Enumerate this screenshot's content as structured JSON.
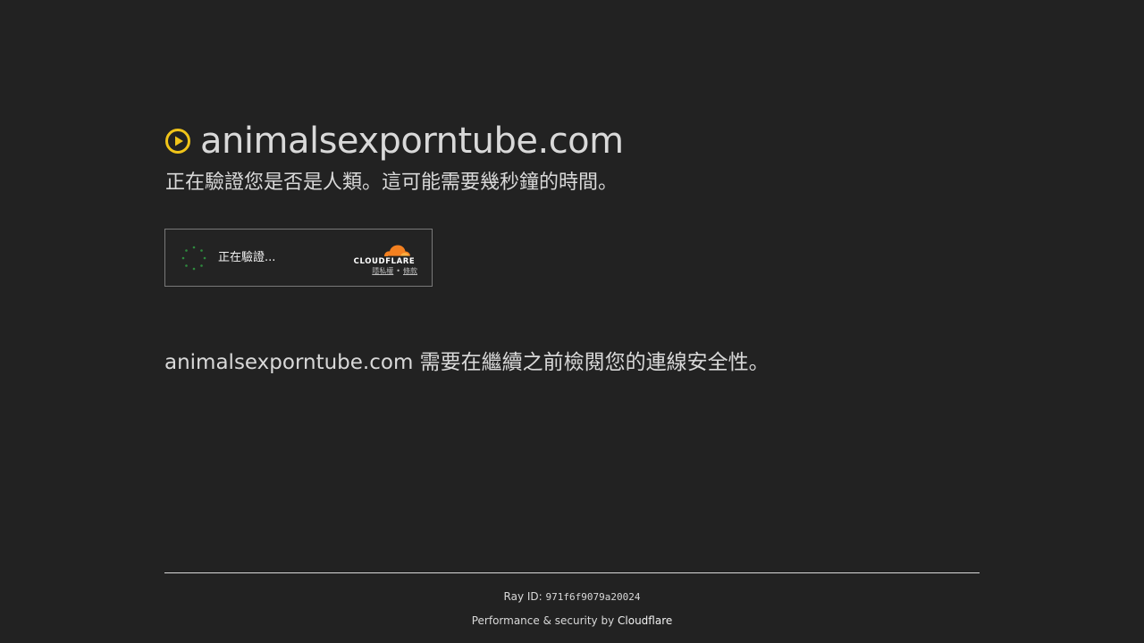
{
  "header": {
    "site_name": "animalsexporntube.com",
    "icon": "play-circle-icon",
    "icon_color": "#f0c419"
  },
  "subtitle": "正在驗證您是否是人類。這可能需要幾秒鐘的時間。",
  "widget": {
    "status_label": "正在驗證...",
    "spinner_icon": "loading-spinner-icon",
    "spinner_color": "#2e8b3e",
    "brand_logo": "cloudflare-logo",
    "brand_text": "CLOUDFLARE",
    "brand_color": "#f38020",
    "privacy_link": "隱私權",
    "separator": "•",
    "terms_link": "條款"
  },
  "message": {
    "site_name": "animalsexporntube.com",
    "text": " 需要在繼續之前檢閱您的連線安全性。"
  },
  "footer": {
    "ray_label": "Ray ID: ",
    "ray_id": "971f6f9079a20024",
    "perf_text": "Performance & security by ",
    "brand_link": "Cloudflare"
  }
}
